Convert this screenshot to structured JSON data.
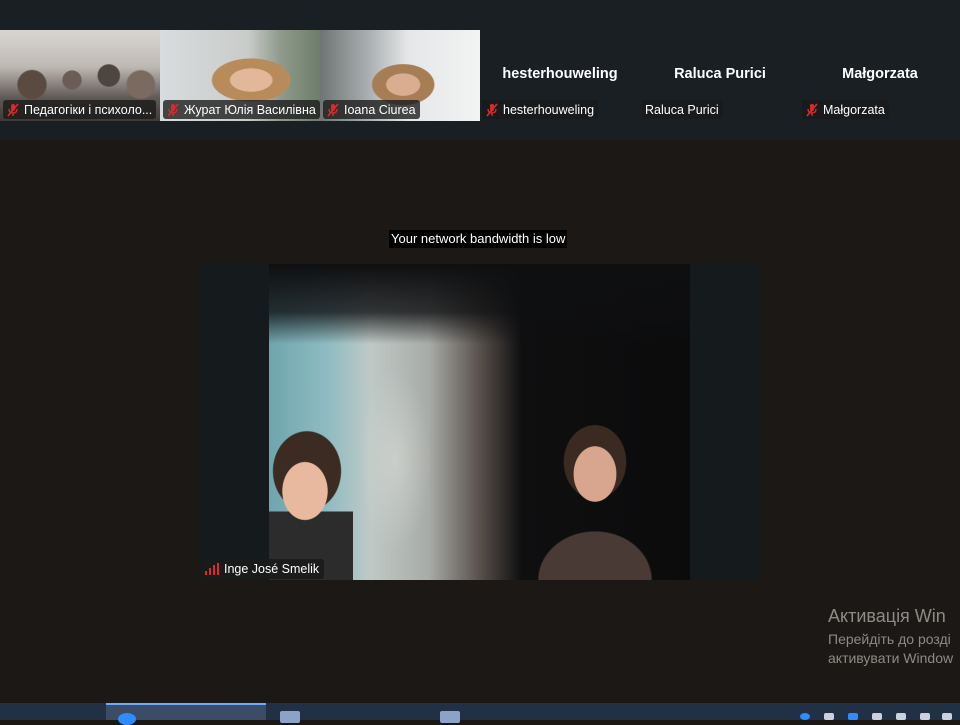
{
  "gallery": {
    "tiles": [
      {
        "name": "Педагогіки і психоло..."
      },
      {
        "name": "Журат Юлія Василівна"
      },
      {
        "name": "Ioana Ciurea"
      }
    ],
    "avatars": [
      {
        "display": "hesterhouweling",
        "name": "hesterhouweling",
        "muted": true
      },
      {
        "display": "Raluca Purici",
        "name": "Raluca Purici",
        "muted": false
      },
      {
        "display": "Małgorzata",
        "name": "Małgorzata",
        "muted": true
      }
    ]
  },
  "stage": {
    "notice": "Your network bandwidth is low",
    "speaker": {
      "name": "Inge José Smelik"
    }
  },
  "watermark": {
    "title": "Активація Win",
    "line1": "Перейдіть до розді",
    "line2": "активувати Window"
  },
  "colors": {
    "mute_red": "#e02828",
    "background": "#1a1714",
    "gallery_bg": "#1a1f23",
    "taskbar": "#223046"
  },
  "icons": [
    "microphone-muted-icon",
    "signal-strength-icon",
    "zoom-app-icon",
    "window-icon"
  ]
}
